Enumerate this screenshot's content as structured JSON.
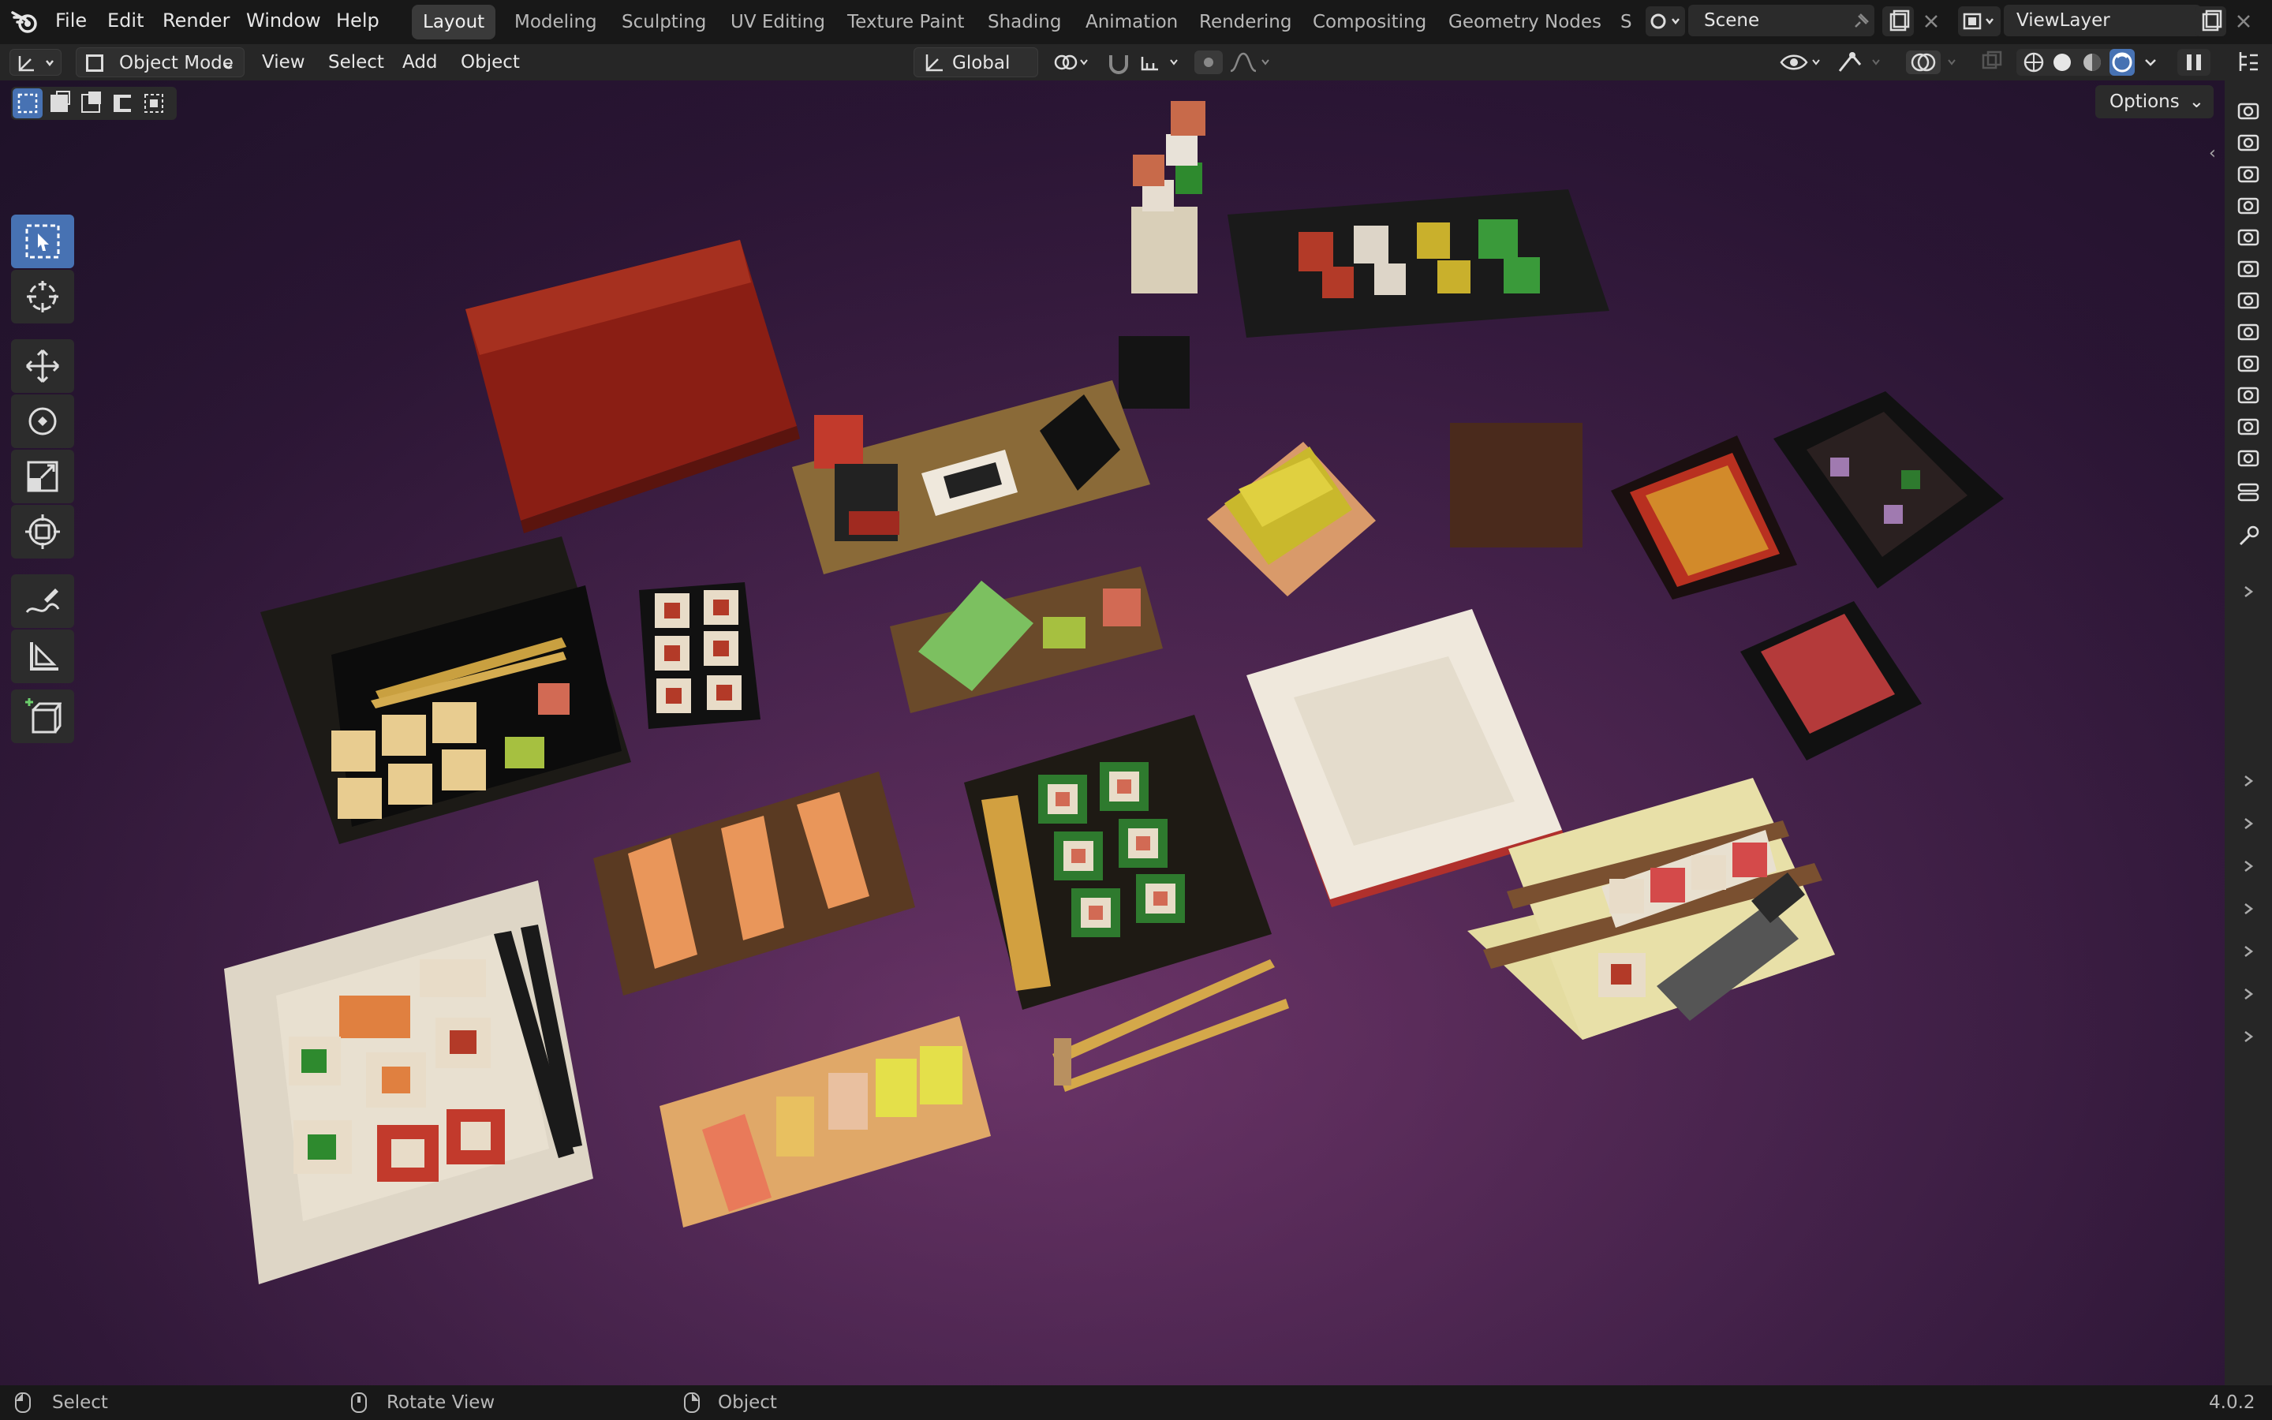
{
  "menu": {
    "items": [
      "File",
      "Edit",
      "Render",
      "Window",
      "Help"
    ]
  },
  "workspaces": {
    "tabs": [
      "Layout",
      "Modeling",
      "Sculpting",
      "UV Editing",
      "Texture Paint",
      "Shading",
      "Animation",
      "Rendering",
      "Compositing",
      "Geometry Nodes",
      "S"
    ],
    "active": "Layout"
  },
  "scene": {
    "name": "Scene"
  },
  "view_layer": {
    "name": "ViewLayer"
  },
  "viewport_header": {
    "mode": "Object Mode",
    "menus": [
      "View",
      "Select",
      "Add",
      "Object"
    ],
    "orientation": "Global",
    "options_label": "Options"
  },
  "status_bar": {
    "left_action": "Select",
    "middle_action": "Rotate View",
    "right_action": "Object",
    "version": "4.0.2"
  },
  "colors": {
    "accent": "#4772b3",
    "viewport_bg": "#3a1c44",
    "ui_dark": "#181818"
  },
  "icons": {
    "blender_logo": "blender-logo-icon",
    "tools": [
      "select-box-icon",
      "cursor-icon",
      "move-icon",
      "rotate-icon",
      "scale-icon",
      "transform-icon",
      "annotate-icon",
      "measure-icon",
      "add-cube-icon"
    ]
  }
}
